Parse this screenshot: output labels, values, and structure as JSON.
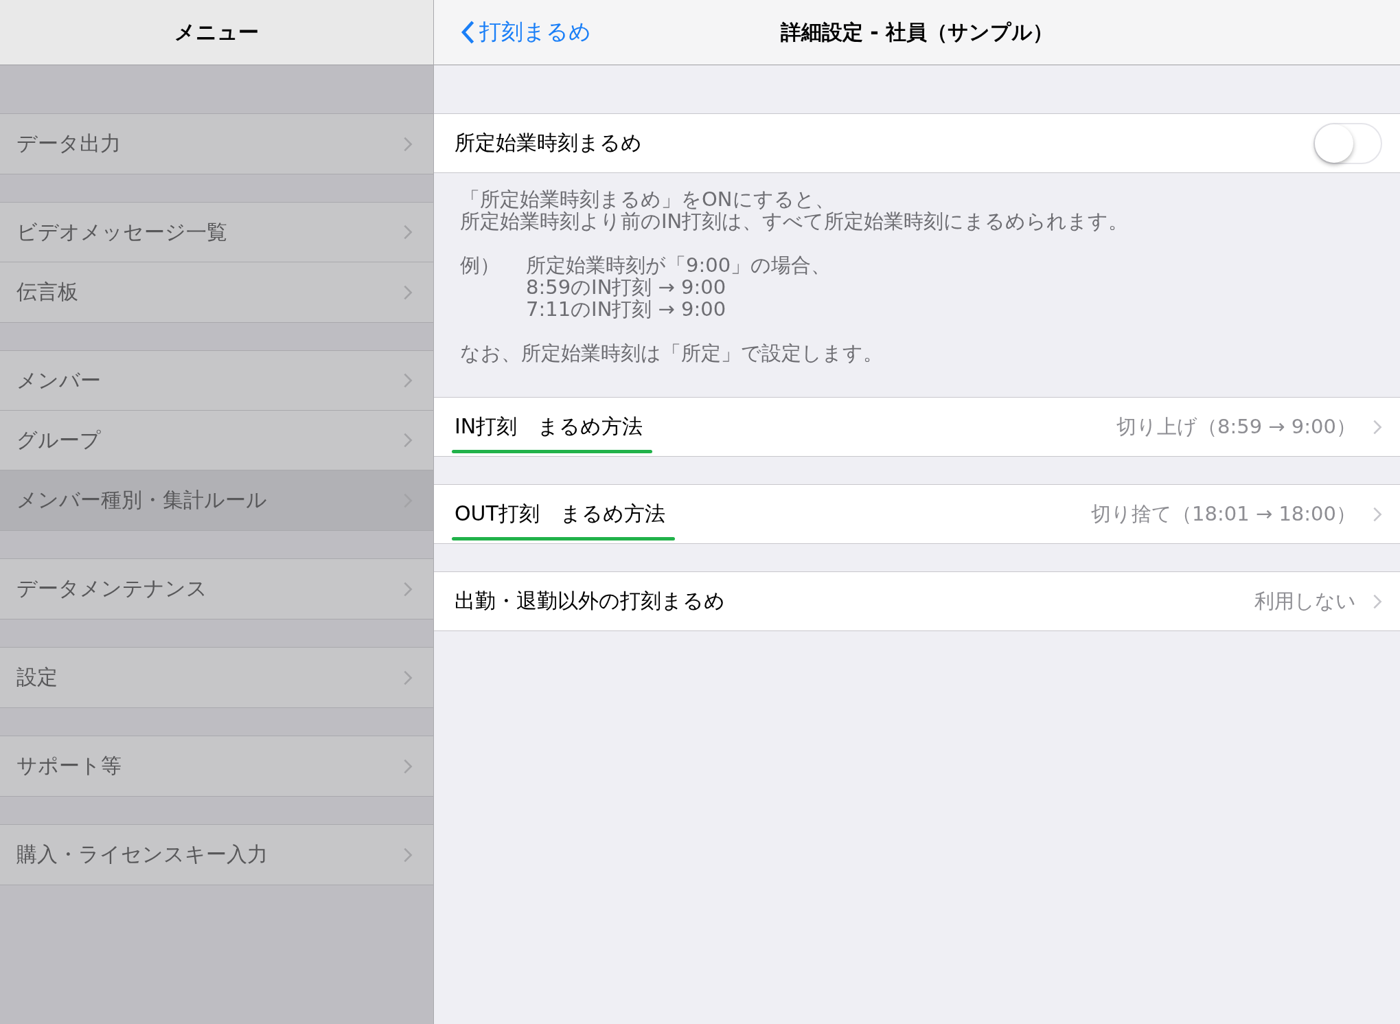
{
  "sidebar": {
    "title": "メニュー",
    "groups": [
      [
        {
          "label": "データ出力",
          "selected": false
        }
      ],
      [
        {
          "label": "ビデオメッセージ一覧",
          "selected": false
        },
        {
          "label": "伝言板",
          "selected": false
        }
      ],
      [
        {
          "label": "メンバー",
          "selected": false
        },
        {
          "label": "グループ",
          "selected": false
        },
        {
          "label": "メンバー種別・集計ルール",
          "selected": true
        }
      ],
      [
        {
          "label": "データメンテナンス",
          "selected": false
        }
      ],
      [
        {
          "label": "設定",
          "selected": false
        }
      ],
      [
        {
          "label": "サポート等",
          "selected": false
        }
      ],
      [
        {
          "label": "購入・ライセンスキー入力",
          "selected": false
        }
      ]
    ]
  },
  "detail": {
    "back": "打刻まるめ",
    "title": "詳細設定 - 社員（サンプル）",
    "toggle_row": {
      "label": "所定始業時刻まるめ",
      "on": false
    },
    "footer": {
      "intro": [
        "「所定始業時刻まるめ」をONにすると、",
        "所定始業時刻より前のIN打刻は、すべて所定始業時刻にまるめられます。"
      ],
      "example_label": "例）",
      "example_lines": [
        "所定始業時刻が「9:00」の場合、",
        "8:59のIN打刻 → 9:00",
        "7:11のIN打刻 → 9:00"
      ],
      "note": "なお、所定始業時刻は「所定」で設定します。"
    },
    "rows": [
      {
        "label": "IN打刻　まるめ方法",
        "value": "切り上げ（8:59 → 9:00）",
        "underlined": true
      },
      {
        "label": "OUT打刻　まるめ方法",
        "value": "切り捨て（18:01 → 18:00）",
        "underlined": true
      },
      {
        "label": "出勤・退勤以外の打刻まるめ",
        "value": "利用しない",
        "underlined": false
      }
    ]
  }
}
